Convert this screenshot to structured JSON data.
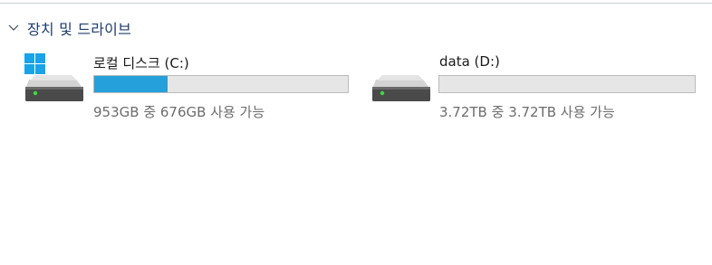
{
  "section": {
    "title": "장치 및 드라이브",
    "chevron_icon": "chevron-down-icon"
  },
  "drives": [
    {
      "name": "로컬 디스크 (C:)",
      "space_text": "953GB 중 676GB 사용 가능",
      "used_fraction": 0.29,
      "icon": "system-drive-icon",
      "bar_color": "#26a0da"
    },
    {
      "name": "data (D:)",
      "space_text": "3.72TB 중 3.72TB 사용 가능",
      "used_fraction": 0.0,
      "icon": "hard-drive-icon",
      "bar_color": "#26a0da"
    }
  ],
  "colors": {
    "accent": "#26a0da",
    "section_title": "#1e3c6e",
    "bar_track": "#e6e6e6",
    "drive_led": "#3ddc3d"
  }
}
